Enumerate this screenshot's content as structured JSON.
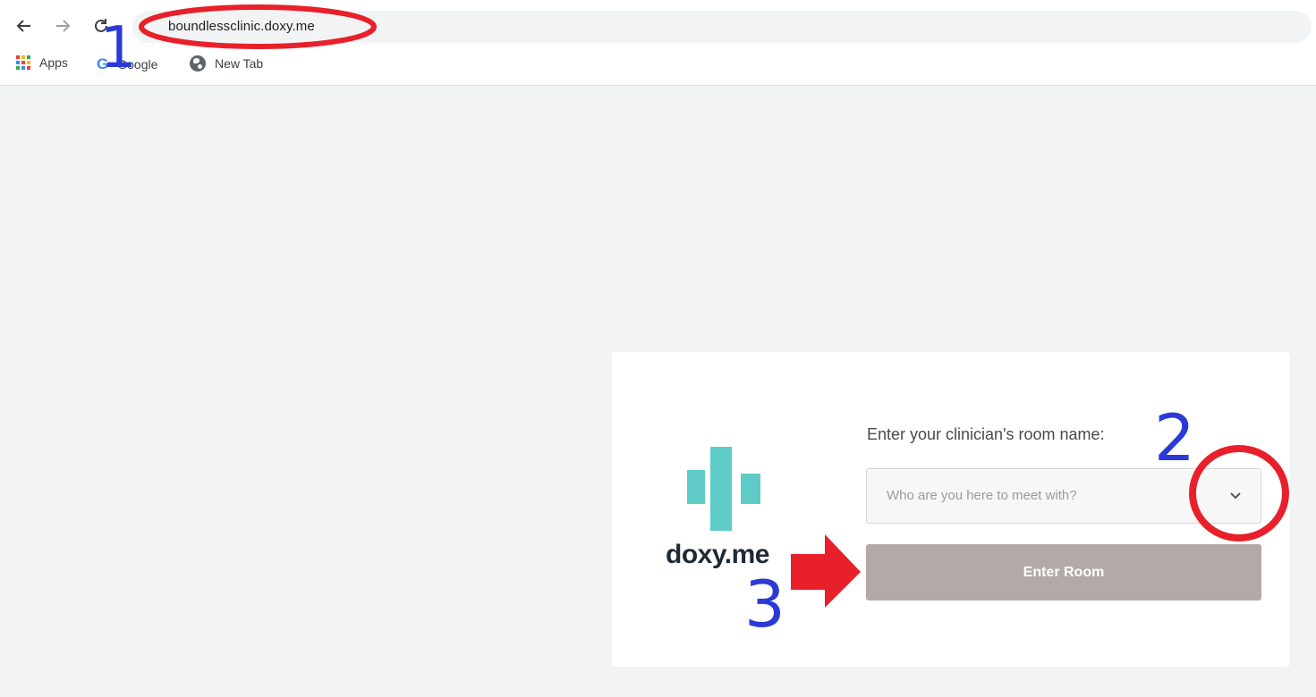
{
  "browser": {
    "url": "boundlessclinic.doxy.me",
    "bookmarks": [
      {
        "label": "Apps",
        "icon": "apps-grid-icon"
      },
      {
        "label": "Google",
        "icon": "google-g-icon"
      },
      {
        "label": "New Tab",
        "icon": "globe-icon"
      }
    ]
  },
  "card": {
    "logo_text": "doxy.me",
    "room_label": "Enter your clinician's room name:",
    "select_placeholder": "Who are you here to meet with?",
    "enter_button": "Enter Room"
  },
  "annotations": {
    "step1": "1",
    "step2": "2",
    "step3": "3",
    "highlight_color": "#e8202a",
    "number_color": "#2b3ad6"
  },
  "colors": {
    "brand_teal": "#5ecbc7",
    "button_bg": "#b3aaa7",
    "page_bg": "#f2f3f3"
  }
}
